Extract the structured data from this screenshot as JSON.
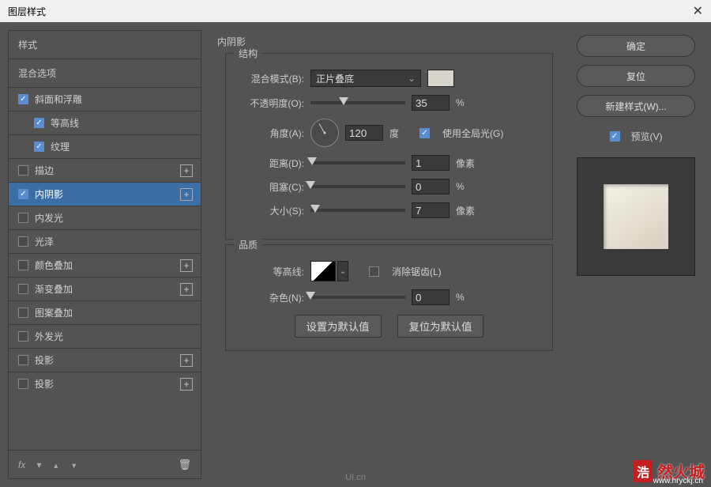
{
  "title": "图层样式",
  "left": {
    "styles_label": "样式",
    "blend_options_label": "混合选项",
    "items": [
      {
        "label": "斜面和浮雕",
        "checked": true,
        "add": false,
        "indent": false
      },
      {
        "label": "等高线",
        "checked": true,
        "add": false,
        "indent": true
      },
      {
        "label": "纹理",
        "checked": true,
        "add": false,
        "indent": true
      },
      {
        "label": "描边",
        "checked": false,
        "add": true,
        "indent": false
      },
      {
        "label": "内阴影",
        "checked": true,
        "add": true,
        "indent": false,
        "selected": true
      },
      {
        "label": "内发光",
        "checked": false,
        "add": false,
        "indent": false
      },
      {
        "label": "光泽",
        "checked": false,
        "add": false,
        "indent": false
      },
      {
        "label": "颜色叠加",
        "checked": false,
        "add": true,
        "indent": false
      },
      {
        "label": "渐变叠加",
        "checked": false,
        "add": true,
        "indent": false
      },
      {
        "label": "图案叠加",
        "checked": false,
        "add": false,
        "indent": false
      },
      {
        "label": "外发光",
        "checked": false,
        "add": false,
        "indent": false
      },
      {
        "label": "投影",
        "checked": false,
        "add": true,
        "indent": false
      },
      {
        "label": "投影",
        "checked": false,
        "add": true,
        "indent": false
      }
    ],
    "fx_label": "fx"
  },
  "center": {
    "title": "内阴影",
    "struct_label": "结构",
    "blend_mode_label": "混合模式(B):",
    "blend_mode_value": "正片叠底",
    "opacity_label": "不透明度(O):",
    "opacity_value": "35",
    "opacity_unit": "%",
    "angle_label": "角度(A):",
    "angle_value": "120",
    "angle_unit": "度",
    "global_light_label": "使用全局光(G)",
    "global_light_checked": true,
    "distance_label": "距离(D):",
    "distance_value": "1",
    "distance_unit": "像素",
    "choke_label": "阻塞(C):",
    "choke_value": "0",
    "choke_unit": "%",
    "size_label": "大小(S):",
    "size_value": "7",
    "size_unit": "像素",
    "quality_label": "品质",
    "contour_label": "等高线:",
    "antialias_label": "消除锯齿(L)",
    "antialias_checked": false,
    "noise_label": "杂色(N):",
    "noise_value": "0",
    "noise_unit": "%",
    "set_default": "设置为默认值",
    "reset_default": "复位为默认值"
  },
  "right": {
    "ok": "确定",
    "cancel": "复位",
    "new_style": "新建样式(W)...",
    "preview_label": "预览(V)",
    "preview_checked": true
  },
  "watermark": {
    "brand": "浩",
    "text": "然火城",
    "url": "www.hryckj.cn"
  },
  "ui_logo": "UI.cn"
}
